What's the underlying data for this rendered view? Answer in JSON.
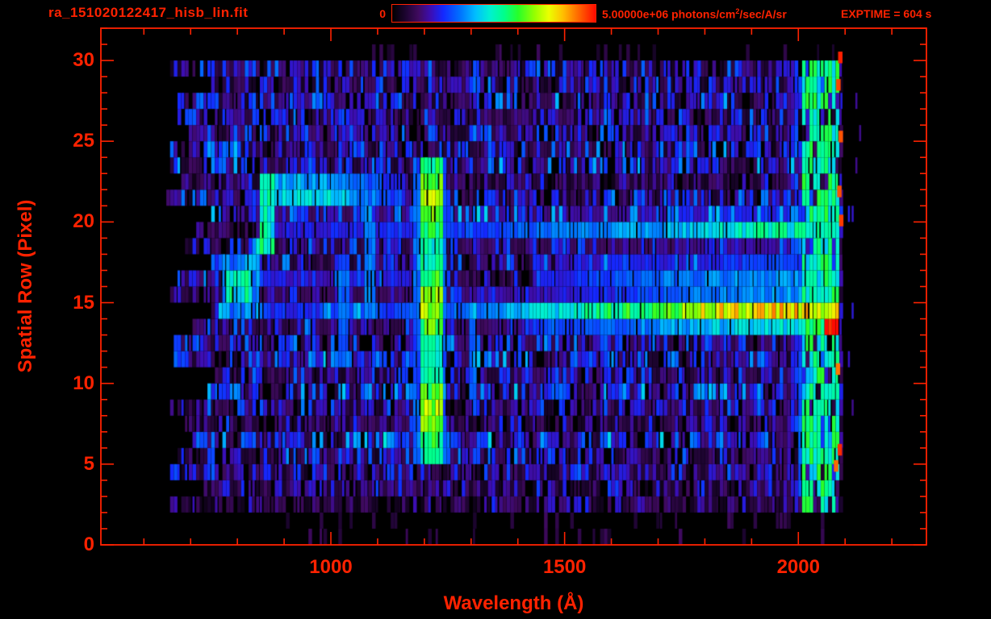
{
  "colors": {
    "accent": "#ff2200",
    "background": "#000000"
  },
  "header": {
    "title": "ra_151020122417_hisb_lin.fit",
    "colorbar": {
      "min_label": "0",
      "max_value": "5.00000e+06",
      "unit_prefix": " photons/cm",
      "unit_sup": "2",
      "unit_suffix": "/sec/A/sr",
      "exptime_label": "EXPTIME = 604 s"
    }
  },
  "chart_data": {
    "type": "heatmap",
    "title": "ra_151020122417_hisb_lin.fit",
    "xlabel": "Wavelength (Å)",
    "ylabel": "Spatial Row (Pixel)",
    "xlim": [
      508,
      2274
    ],
    "ylim": [
      0,
      32
    ],
    "x_major_ticks": [
      1000,
      1500,
      2000
    ],
    "x_minor_tick_start": 600,
    "x_minor_tick_end": 2200,
    "x_minor_step": 100,
    "y_major_ticks": [
      0,
      5,
      10,
      15,
      20,
      25,
      30
    ],
    "y_minor_step": 1,
    "colorbar_range_photons": [
      0,
      5000000
    ],
    "colorbar_units": "photons/cm2/sec/A/sr",
    "exposure_seconds": 604,
    "grid": false,
    "data_extent": {
      "wavelength": [
        640,
        2090
      ],
      "rows": [
        0,
        31
      ]
    },
    "colormap_stops": [
      [
        0.0,
        0,
        0,
        0
      ],
      [
        0.06,
        26,
        4,
        44
      ],
      [
        0.13,
        64,
        10,
        96
      ],
      [
        0.19,
        60,
        14,
        180
      ],
      [
        0.25,
        20,
        40,
        255
      ],
      [
        0.33,
        0,
        110,
        255
      ],
      [
        0.41,
        0,
        190,
        255
      ],
      [
        0.48,
        0,
        240,
        210
      ],
      [
        0.55,
        0,
        255,
        140
      ],
      [
        0.62,
        40,
        255,
        40
      ],
      [
        0.7,
        150,
        255,
        0
      ],
      [
        0.77,
        235,
        255,
        0
      ],
      [
        0.84,
        255,
        190,
        0
      ],
      [
        0.91,
        255,
        110,
        0
      ],
      [
        1.0,
        255,
        10,
        0
      ]
    ],
    "noise": {
      "seed": 1234,
      "bin_angstroms": 8,
      "sparse_rows": [
        0,
        1,
        30
      ],
      "black_fraction": 0.1,
      "left_edge_min": 640,
      "left_edge_jitter": 110,
      "right_edge": 2090,
      "faint_overscan_to": 2140
    },
    "features": [
      {
        "name": "lyman-alpha-emission-line",
        "kind": "vline",
        "wavelength": 1214,
        "half_width": 24,
        "rows": [
          4.9,
          24.2
        ],
        "intensity": 0.58,
        "fringe": 0.3,
        "wave_mod": true
      },
      {
        "name": "emission-line-1025",
        "kind": "vline",
        "wavelength": 1027,
        "half_width": 10,
        "rows": [
          12.5,
          17.5
        ],
        "intensity": 0.3
      },
      {
        "name": "emission-line-1085",
        "kind": "vline",
        "wavelength": 1085,
        "half_width": 10,
        "rows": [
          14.5,
          20.2
        ],
        "intensity": 0.33
      },
      {
        "name": "emission-line-1304",
        "kind": "vline",
        "wavelength": 1302,
        "half_width": 9,
        "rows": [
          9.2,
          13.6
        ],
        "intensity": 0.3
      },
      {
        "name": "continuum-band-row14.5",
        "kind": "hband",
        "row": 14.55,
        "sigma": 0.75,
        "profile": [
          [
            770,
            0.22
          ],
          [
            1235,
            0.3
          ],
          [
            1450,
            0.42
          ],
          [
            1600,
            0.55
          ],
          [
            1750,
            0.68
          ],
          [
            1850,
            0.78
          ],
          [
            1950,
            0.82
          ],
          [
            2088,
            0.78
          ]
        ]
      },
      {
        "name": "band-row16",
        "kind": "hband",
        "row": 16.05,
        "sigma": 0.55,
        "profile": [
          [
            1430,
            0.28
          ],
          [
            1700,
            0.45
          ],
          [
            2000,
            0.52
          ],
          [
            2088,
            0.46
          ]
        ]
      },
      {
        "name": "band-row13.5",
        "kind": "hband",
        "row": 13.55,
        "sigma": 0.5,
        "profile": [
          [
            1420,
            0.25
          ],
          [
            1800,
            0.4
          ],
          [
            2088,
            0.5
          ]
        ]
      },
      {
        "name": "band-row17",
        "kind": "hband",
        "row": 17.3,
        "sigma": 0.5,
        "profile": [
          [
            1480,
            0.22
          ],
          [
            2088,
            0.3
          ]
        ]
      },
      {
        "name": "band-row19.6",
        "kind": "hband",
        "row": 19.6,
        "sigma": 0.75,
        "profile": [
          [
            880,
            0.22
          ],
          [
            1300,
            0.28
          ],
          [
            1700,
            0.38
          ],
          [
            1900,
            0.5
          ],
          [
            2088,
            0.5
          ]
        ]
      },
      {
        "name": "left-trace-top-band",
        "kind": "hband",
        "row": 21.9,
        "sigma": 0.85,
        "profile": [
          [
            846,
            0.48
          ],
          [
            1000,
            0.5
          ],
          [
            1050,
            0.42
          ],
          [
            1120,
            0.33
          ],
          [
            1160,
            0.28
          ]
        ]
      },
      {
        "name": "left-trace-faint-band",
        "kind": "hband",
        "row": 16.6,
        "sigma": 0.6,
        "profile": [
          [
            845,
            0.22
          ],
          [
            1185,
            0.2
          ]
        ]
      },
      {
        "name": "left-trace-bend",
        "kind": "blob",
        "wavelength": [
          846,
          882
        ],
        "rows": [
          18.4,
          22.8
        ],
        "intensity": 0.5
      },
      {
        "name": "left-trace-diagonal",
        "kind": "diag",
        "wavelength": [
          788,
          858
        ],
        "row_start": 15.6,
        "row_end": 19.0,
        "sigma": 0.8,
        "intensity": 0.44
      },
      {
        "name": "left-blob",
        "kind": "blob",
        "wavelength": [
          766,
          846
        ],
        "rows": [
          13.6,
          17.6
        ],
        "intensity": 0.34
      },
      {
        "name": "left-blob-core",
        "kind": "blob",
        "wavelength": [
          776,
          830
        ],
        "rows": [
          14.6,
          16.9
        ],
        "intensity": 0.48
      },
      {
        "name": "airglow-ramp",
        "kind": "vband",
        "wavelength": [
          1940,
          2010
        ],
        "rows": [
          2.2,
          30.4
        ],
        "intensity": 0.3,
        "ramp": true,
        "fill": 0.6
      },
      {
        "name": "airglow-column",
        "kind": "vband",
        "wavelength": [
          2005,
          2090
        ],
        "rows": [
          2.2,
          30.4
        ],
        "intensity": 0.5,
        "fill": 0.82
      },
      {
        "name": "red-hotspot",
        "kind": "blob",
        "wavelength": [
          2058,
          2090
        ],
        "rows": [
          13.0,
          14.2
        ],
        "intensity": 0.97
      },
      {
        "name": "edge-hot-specks",
        "kind": "specks",
        "intensity": 0.9,
        "points": [
          [
            2085,
            29.9
          ],
          [
            2081,
            28.2
          ],
          [
            2086,
            25.0
          ],
          [
            2083,
            21.6
          ],
          [
            2087,
            19.8
          ],
          [
            2080,
            10.6
          ],
          [
            2084,
            5.6
          ],
          [
            2076,
            4.6
          ]
        ]
      }
    ]
  }
}
